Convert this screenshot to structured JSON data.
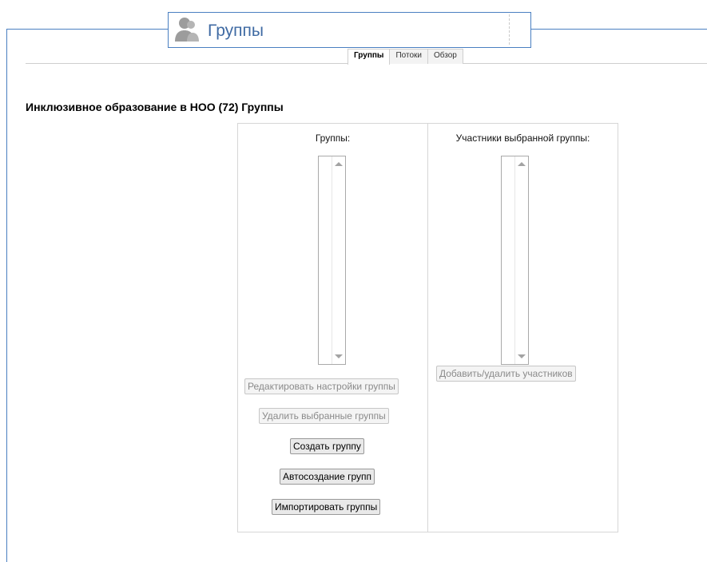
{
  "header": {
    "title": "Группы",
    "icon": "users-icon"
  },
  "tabs": [
    {
      "label": "Группы",
      "active": true
    },
    {
      "label": "Потоки",
      "active": false
    },
    {
      "label": "Обзор",
      "active": false
    }
  ],
  "page_title": "Инклюзивное образование в НОО (72) Группы",
  "groups_column": {
    "label": "Группы:",
    "buttons": {
      "edit": "Редактировать настройки группы",
      "delete": "Удалить выбранные группы",
      "create": "Создать группу",
      "autocreate": "Автосоздание групп",
      "import": "Импортировать группы"
    }
  },
  "members_column": {
    "label": "Участники выбранной группы:",
    "buttons": {
      "add_remove": "Добавить/удалить участников"
    }
  },
  "colors": {
    "accent": "#4a7fc1",
    "title_text": "#3f6aa3"
  }
}
